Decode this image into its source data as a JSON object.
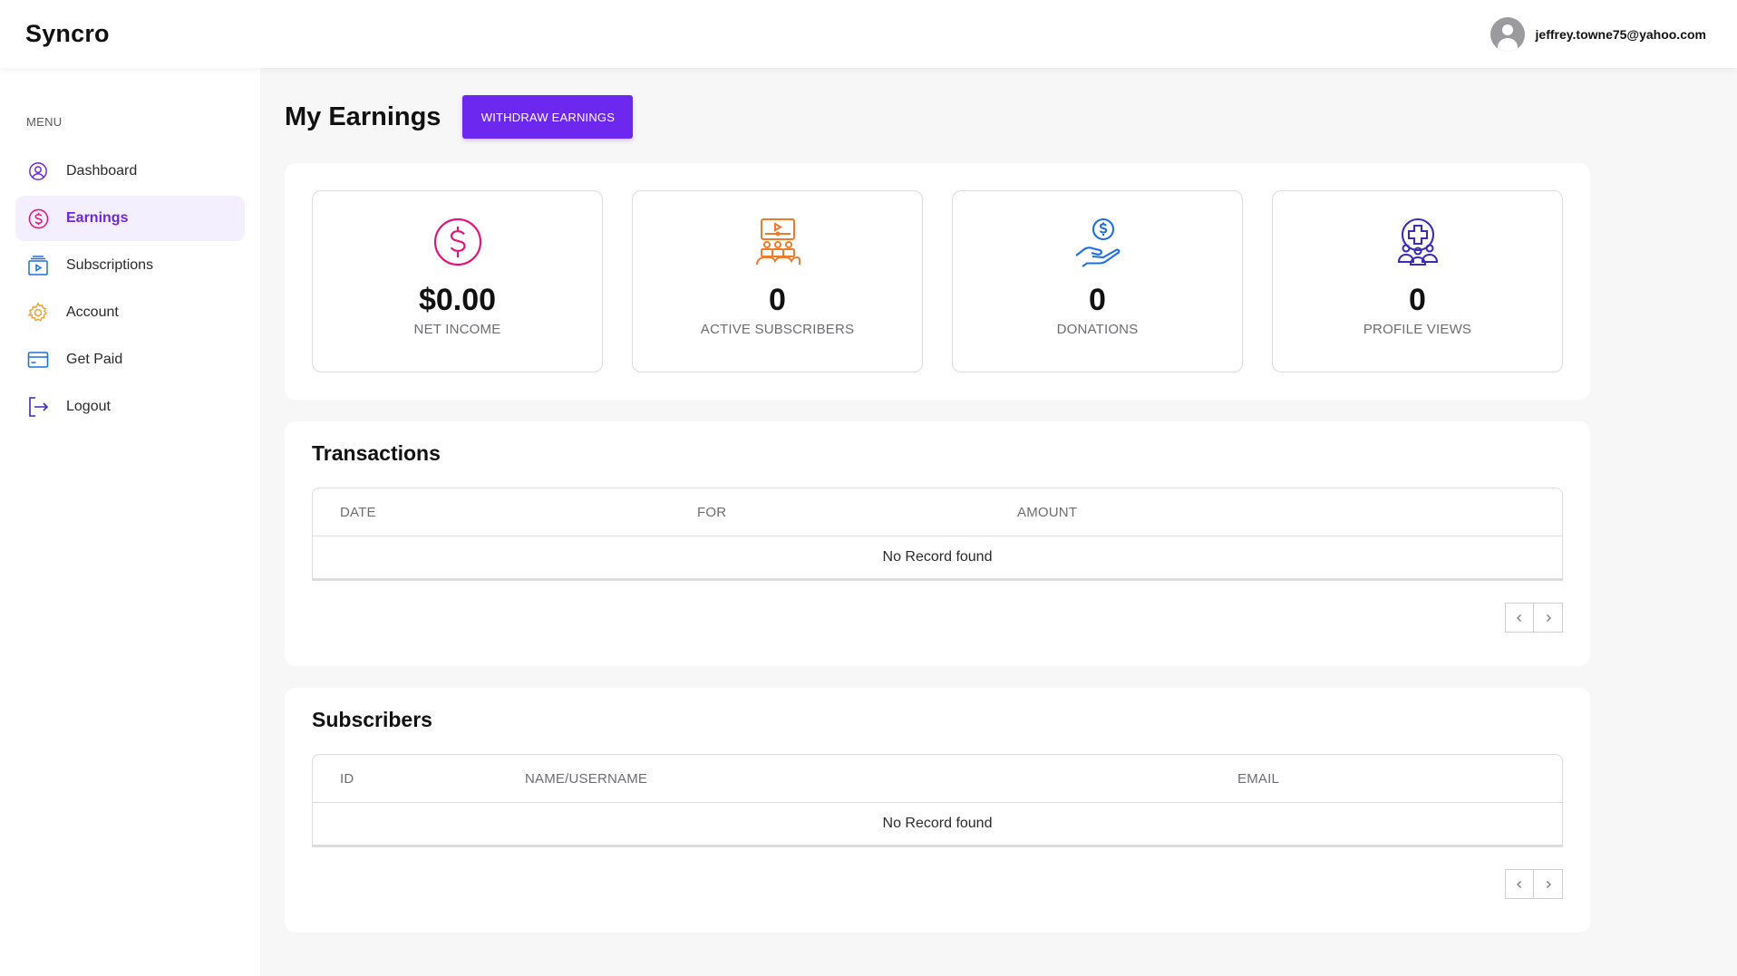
{
  "header": {
    "logo": "Syncro",
    "user_email": "jeffrey.towne75@yahoo.com"
  },
  "sidebar": {
    "menu_title": "MENU",
    "items": [
      {
        "label": "Dashboard",
        "icon": "user-circle-icon",
        "active": false
      },
      {
        "label": "Earnings",
        "icon": "dollar-circle-icon",
        "active": true
      },
      {
        "label": "Subscriptions",
        "icon": "subscriptions-icon",
        "active": false
      },
      {
        "label": "Account",
        "icon": "gear-icon",
        "active": false
      },
      {
        "label": "Get Paid",
        "icon": "credit-card-icon",
        "active": false
      },
      {
        "label": "Logout",
        "icon": "logout-icon",
        "active": false
      }
    ]
  },
  "main": {
    "page_title": "My Earnings",
    "withdraw_label": "WITHDRAW EARNINGS",
    "stats": [
      {
        "value": "$0.00",
        "label": "NET INCOME",
        "icon": "dollar-circle-icon",
        "color": "#e4157a"
      },
      {
        "value": "0",
        "label": "ACTIVE SUBSCRIBERS",
        "icon": "audience-screen-icon",
        "color": "#f07a2b"
      },
      {
        "value": "0",
        "label": "DONATIONS",
        "icon": "donation-hand-icon",
        "color": "#1f6fe0"
      },
      {
        "value": "0",
        "label": "PROFILE VIEWS",
        "icon": "profile-group-icon",
        "color": "#3a2bb8"
      }
    ],
    "transactions": {
      "title": "Transactions",
      "columns": [
        "DATE",
        "FOR",
        "AMOUNT"
      ],
      "empty_text": "No Record found"
    },
    "subscribers": {
      "title": "Subscribers",
      "columns": [
        "ID",
        "NAME/USERNAME",
        "EMAIL"
      ],
      "empty_text": "No Record found"
    }
  },
  "colors": {
    "accent": "#6d28f0",
    "active_text": "#6d28d9",
    "active_bg": "#f3efff"
  }
}
